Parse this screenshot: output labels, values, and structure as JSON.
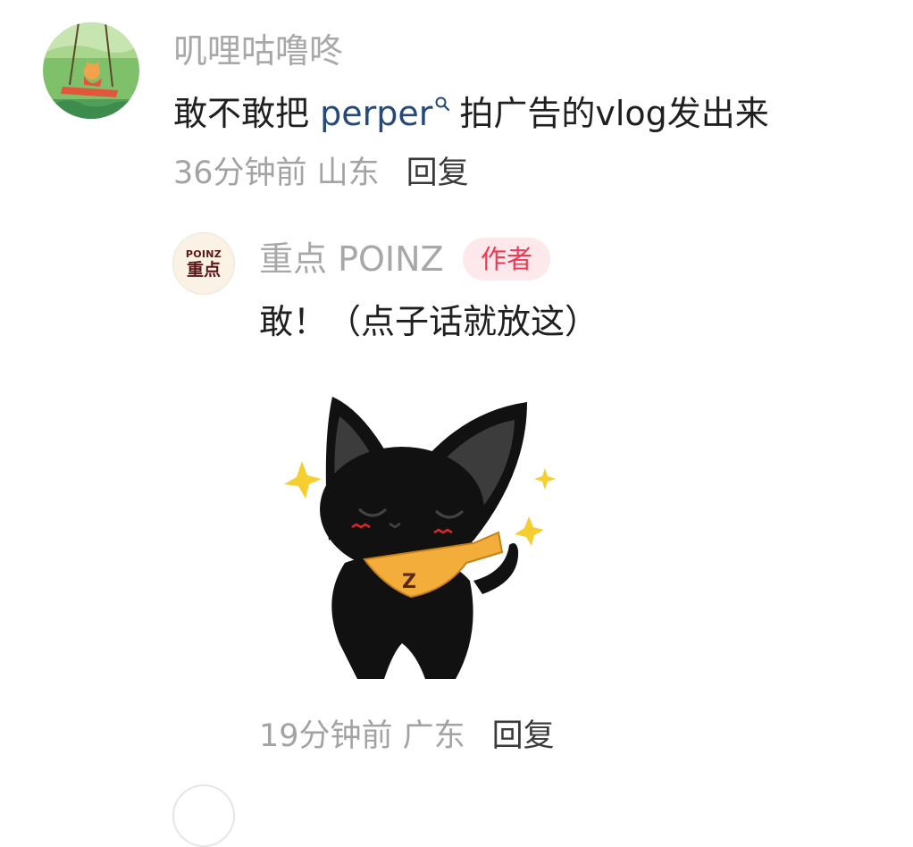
{
  "comment": {
    "author": "叽哩咕噜咚",
    "text_before": "敢不敢把 ",
    "mention": "perper",
    "text_after": "拍广告的vlog发出来",
    "time_location": "36分钟前 山东",
    "reply_label": "回复"
  },
  "reply": {
    "avatar_logo_en": "POINZ",
    "avatar_logo_zh": "重点",
    "author": "重点 POINZ",
    "badge": "作者",
    "text": "敢！（点子话就放这）",
    "sticker_letter": "Z",
    "time_location": "19分钟前 广东",
    "reply_label": "回复"
  },
  "colors": {
    "mention": "#24497a",
    "badge_text": "#ef3a55",
    "badge_bg": "#fde9ec",
    "muted": "#a8a8a8"
  }
}
